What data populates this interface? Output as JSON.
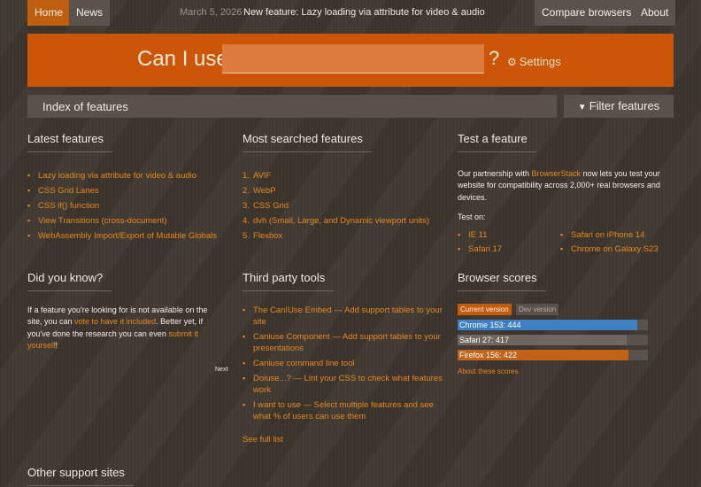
{
  "nav": {
    "home": "Home",
    "news": "News",
    "news_date": "March 5, 2026 ·",
    "news_text": "New feature: Lazy loading via attribute for video & audio",
    "compare": "Compare browsers",
    "about": "About"
  },
  "search": {
    "label": "Can I use",
    "value": "",
    "question_mark": "?",
    "settings_label": "Settings"
  },
  "index": {
    "title": "Index of features",
    "filter_label": "Filter features"
  },
  "latest": {
    "title": "Latest features",
    "items": [
      "Lazy loading via attribute for video & audio",
      "CSS Grid Lanes",
      "CSS if() function",
      "View Transitions (cross-document)",
      "WebAssembly Import/Export of Mutable Globals"
    ]
  },
  "most_searched": {
    "title": "Most searched features",
    "items": [
      {
        "num": "1.",
        "label": "AVIF"
      },
      {
        "num": "2.",
        "label": "WebP"
      },
      {
        "num": "3.",
        "label": "CSS Grid"
      },
      {
        "num": "4.",
        "label": "dvh (Small, Large, and Dynamic viewport units)"
      },
      {
        "num": "5.",
        "label": "Flexbox"
      }
    ]
  },
  "test_feature": {
    "title": "Test a feature",
    "text_before": "Our partnership with ",
    "link": "BrowserStack",
    "text_after": " now lets you test your website for compatibility across 2,000+ real browsers and devices.",
    "test_on": "Test on:",
    "browsers": [
      "IE 11",
      "Safari on iPhone 14",
      "Safari 17",
      "Chrome on Galaxy S23"
    ]
  },
  "did_you_know": {
    "title": "Did you know?",
    "text1": "If a feature you're looking for is not available on the site, you can ",
    "link1": "vote to have it included",
    "text2": ". Better yet, if you've done the research you can even ",
    "link2": "submit it yourself",
    "text3": "!",
    "next": "Next"
  },
  "third_party": {
    "title": "Third party tools",
    "items": [
      "The CanIUse Embed — Add support tables to your site",
      "Caniuse Component — Add support tables to your presentations",
      "Caniuse command line tool",
      "Doiuse...? — Lint your CSS to check what features work",
      "I want to use — Select multiple features and see what % of users can use them"
    ],
    "see_full": "See full list"
  },
  "scores": {
    "title": "Browser scores",
    "tab_current": "Current version",
    "tab_dev": "Dev version",
    "max": 470,
    "bars": [
      {
        "label": "Chrome 153: 444",
        "value": 444,
        "color": "#3f7fc4"
      },
      {
        "label": "Safari 27: 417",
        "value": 417,
        "color": "#6e675f"
      },
      {
        "label": "Firefox 156: 422",
        "value": 422,
        "color": "#c2631a"
      }
    ],
    "about": "About these scores"
  },
  "other": {
    "title": "Other support sites"
  },
  "colors": {
    "accent": "#e8871e",
    "banner": "#cc5508",
    "panel": "#5a524a"
  }
}
